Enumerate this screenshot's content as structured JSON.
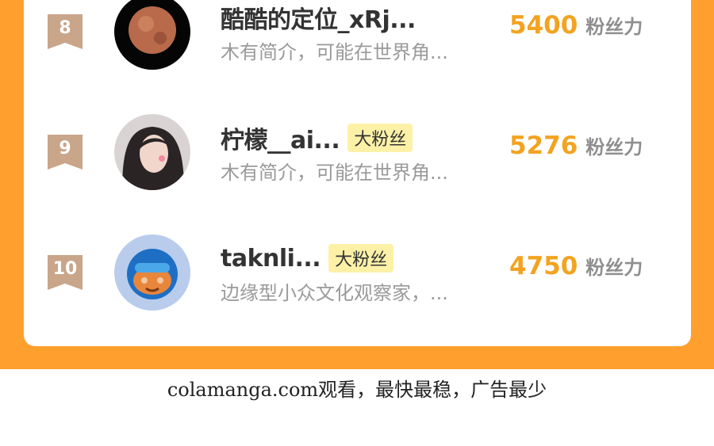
{
  "leaderboard": [
    {
      "rank": "8",
      "name": "酷酷的定位_xRj...",
      "tag": "",
      "description": "木有简介，可能在世界角...",
      "score": "5400",
      "score_unit": "粉丝力",
      "avatar": "planet-avatar"
    },
    {
      "rank": "9",
      "name": "柠檬__ai...",
      "tag": "大粉丝",
      "description": "木有简介，可能在世界角...",
      "score": "5276",
      "score_unit": "粉丝力",
      "avatar": "girl-avatar"
    },
    {
      "rank": "10",
      "name": "taknli...",
      "tag": "大粉丝",
      "description": "边缘型小众文化观察家，...",
      "score": "4750",
      "score_unit": "粉丝力",
      "avatar": "cartoon-avatar"
    }
  ],
  "footer": {
    "text": "colamanga.com观看，最快最稳，广告最少"
  },
  "colors": {
    "accent": "#ff9f2e",
    "score": "#f3a321",
    "tag_bg": "#fdf1a8",
    "badge": "#c9a58a"
  }
}
